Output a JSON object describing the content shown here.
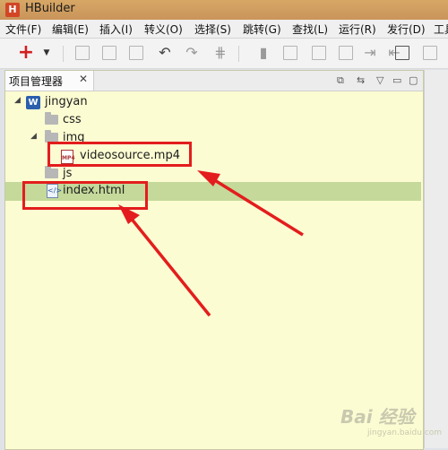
{
  "window": {
    "title": "HBuilder",
    "app_icon": "H"
  },
  "menu": {
    "items": [
      "文件(F)",
      "编辑(E)",
      "插入(I)",
      "转义(O)",
      "选择(S)",
      "跳转(G)",
      "查找(L)",
      "运行(R)",
      "发行(D)",
      "工具"
    ]
  },
  "toolbar": {
    "new_icon": "plus-icon",
    "new_dropdown": "chevron-down-icon",
    "icons": [
      "save-icon",
      "save-all-icon",
      "print-icon",
      "undo-icon",
      "redo-icon",
      "format-icon",
      "bookmark-icon",
      "export-icon",
      "open-icon",
      "import-icon",
      "import-right-icon",
      "import-left-icon",
      "run-icon",
      "file-icon"
    ]
  },
  "panel": {
    "title": "项目管理器",
    "buttons": [
      "collapse-all-icon",
      "link-editor-icon",
      "view-menu-icon",
      "minimize-icon",
      "maximize-icon"
    ]
  },
  "tree": {
    "project": {
      "label": "jingyan",
      "icon_text": "W"
    },
    "items": [
      {
        "label": "css",
        "type": "folder"
      },
      {
        "label": "img",
        "type": "folder"
      },
      {
        "label": "videosource.mp4",
        "type": "mp4-file",
        "icon_text": "MP4"
      },
      {
        "label": "js",
        "type": "folder"
      },
      {
        "label": "index.html",
        "type": "html-file",
        "icon_text": "</>"
      }
    ]
  },
  "annotations": {
    "highlight_color": "#e31d1d",
    "selected_row_color": "#c4d99a"
  },
  "watermark": {
    "text": "Bai 经验",
    "subtext": "jingyan.baidu.com"
  }
}
